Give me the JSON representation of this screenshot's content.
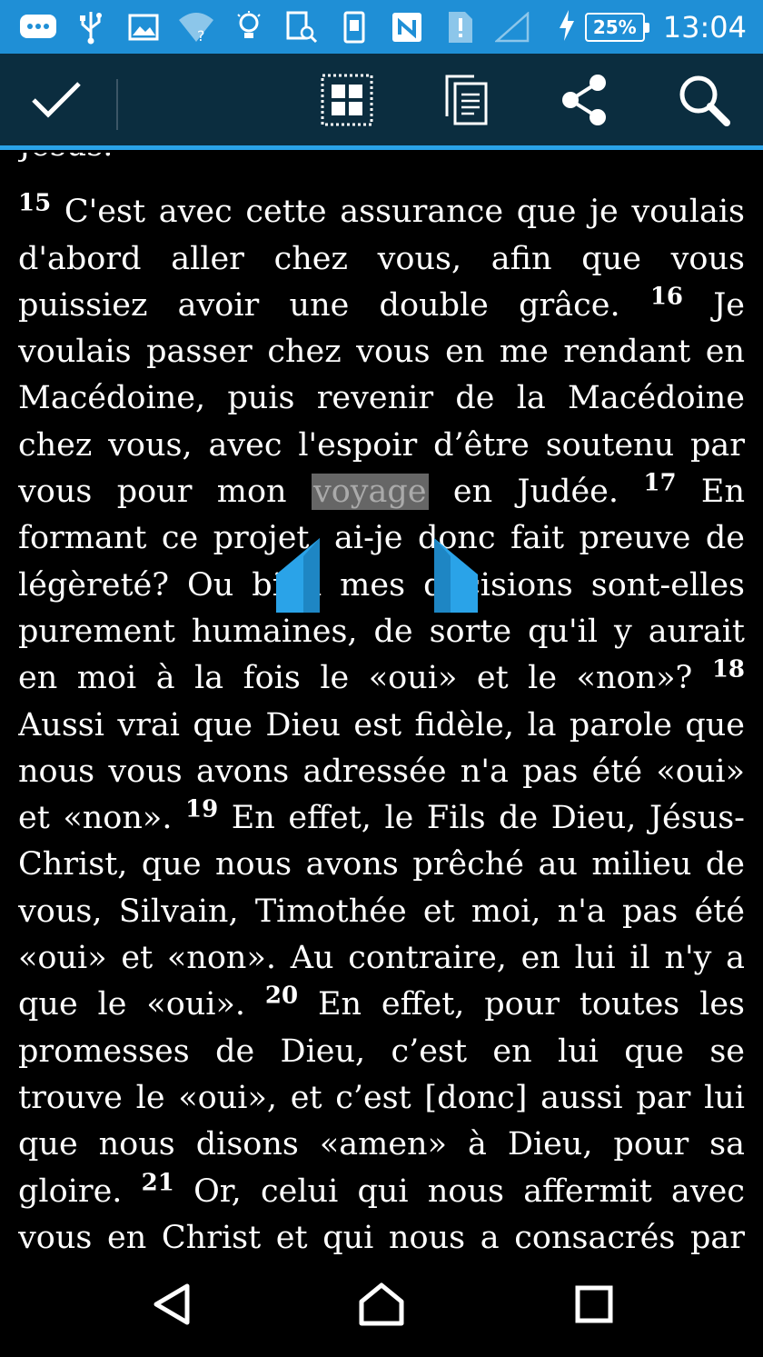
{
  "status_bar": {
    "icons": [
      "chat-bubble-icon",
      "usb-icon",
      "image-icon",
      "wifi-question-icon",
      "lightbulb-icon",
      "screen-search-icon",
      "phone-screen-icon",
      "nfc-icon",
      "sim-alert-icon",
      "signal-empty-icon",
      "charging-bolt-icon"
    ],
    "battery": "25%",
    "time": "13:04"
  },
  "action_bar": {
    "buttons": [
      "check-icon",
      "select-all-icon",
      "copy-icon",
      "share-icon",
      "search-icon"
    ],
    "accent_color": "#2aa3e8",
    "background_color": "#0b2d3f"
  },
  "reading": {
    "top_cut": "Jésus.",
    "segments": {
      "v15_num": "15",
      "v15_text": " C'est avec cette assurance que je voulais d'abord aller chez vous, afin que vous puissiez avoir une double grâce. ",
      "v16_num": "16",
      "v16_text_a": " Je voulais passer chez vous en me rendant en Macédoine, puis revenir de la Macédoine chez vous, avec l'espoir d’être soutenu par vous pour mon ",
      "selected_word": "voyage",
      "v16_text_b": " en Judée. ",
      "v17_num": "17",
      "v17_text": " En formant ce projet, ai-je donc fait preuve de légèreté? Ou bien mes décisions sont-elles purement humaines, de sorte qu'il y aurait en moi à la fois le «oui» et le «non»? ",
      "v18_num": "18",
      "v18_text": " Aussi vrai que Dieu est fidèle, la parole que nous vous avons adressée n'a pas été «oui» et «non». ",
      "v19_num": "19",
      "v19_text": " En effet, le Fils de Dieu, Jésus-Christ, que nous avons prêché au milieu de vous, Silvain, Timothée et moi, n'a pas été «oui» et «non». Au contraire, en lui il n'y a que le «oui». ",
      "v20_num": "20",
      "v20_text": " En effet, pour toutes les promesses de Dieu, c’est en lui que se trouve le «oui», et c’est [donc] aussi par lui que nous disons «amen» à Dieu, pour sa gloire. ",
      "v21_num": "21",
      "v21_text": " Or, celui qui nous affermit avec vous en Christ et qui nous a consacrés par son onction, c'est"
    }
  },
  "nav_bar": {
    "buttons": [
      "back-icon",
      "home-icon",
      "recents-icon"
    ]
  }
}
